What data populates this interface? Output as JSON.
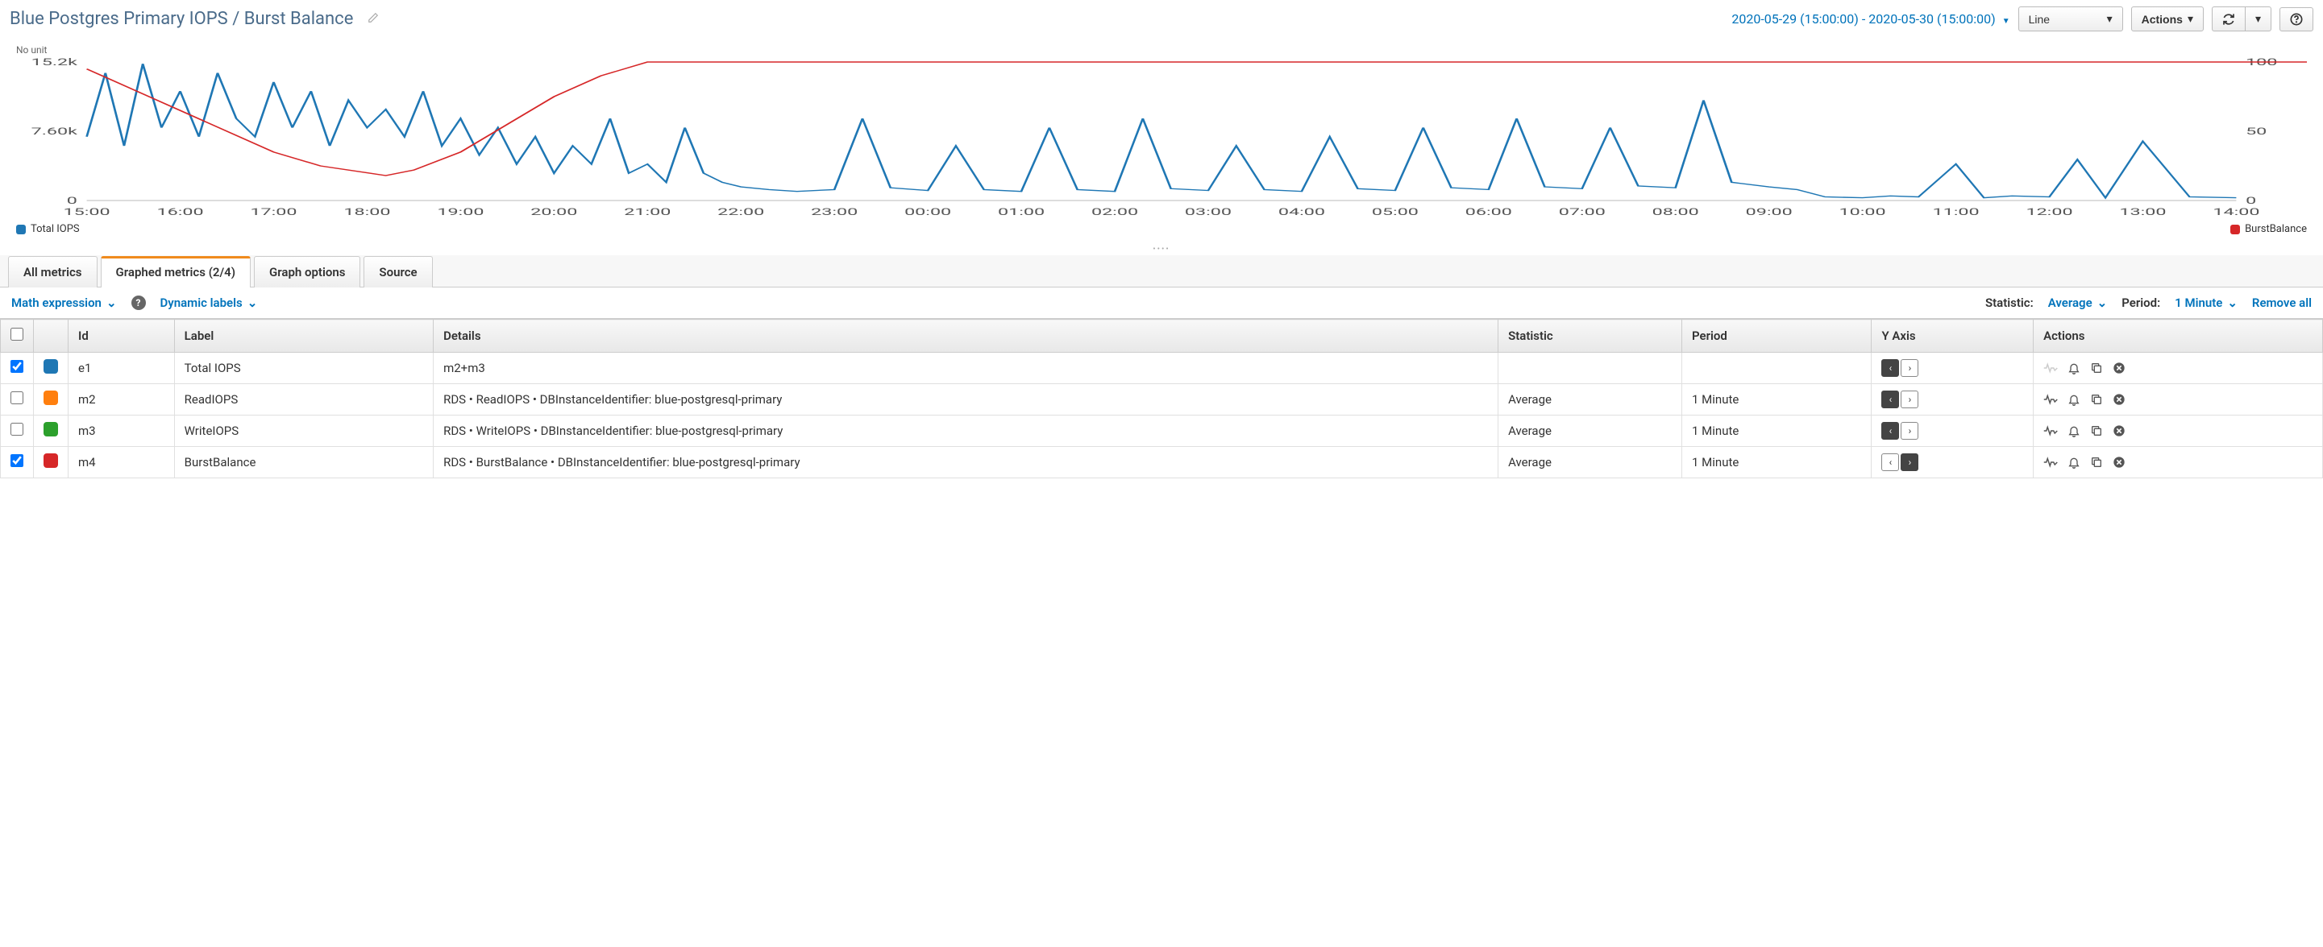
{
  "header": {
    "title": "Blue Postgres Primary IOPS / Burst Balance",
    "time_range": "2020-05-29 (15:00:00) - 2020-05-30 (15:00:00)",
    "chart_type": "Line",
    "actions_label": "Actions"
  },
  "chart": {
    "no_unit_label": "No unit",
    "legend_left": "Total IOPS",
    "legend_right": "BurstBalance",
    "colors": {
      "total_iops": "#1f77b4",
      "burst": "#d62728"
    }
  },
  "chart_data": {
    "type": "line",
    "xlabel": "",
    "x_ticks": [
      "15:00",
      "16:00",
      "17:00",
      "18:00",
      "19:00",
      "20:00",
      "21:00",
      "22:00",
      "23:00",
      "00:00",
      "01:00",
      "02:00",
      "03:00",
      "04:00",
      "05:00",
      "06:00",
      "07:00",
      "08:00",
      "09:00",
      "10:00",
      "11:00",
      "12:00",
      "13:00",
      "14:00"
    ],
    "y_left": {
      "label": "",
      "ticks": [
        0,
        7600,
        15200
      ],
      "tick_labels": [
        "0",
        "7.60k",
        "15.2k"
      ],
      "ylim": [
        0,
        15200
      ]
    },
    "y_right": {
      "label": "",
      "ticks": [
        0,
        50,
        100
      ],
      "ylim": [
        0,
        100
      ]
    },
    "series": [
      {
        "name": "Total IOPS",
        "axis": "left",
        "color": "#1f77b4",
        "x": [
          0,
          0.2,
          0.4,
          0.6,
          0.8,
          1,
          1.2,
          1.4,
          1.6,
          1.8,
          2,
          2.2,
          2.4,
          2.6,
          2.8,
          3,
          3.2,
          3.4,
          3.6,
          3.8,
          4,
          4.2,
          4.4,
          4.6,
          4.8,
          5,
          5.2,
          5.4,
          5.6,
          5.8,
          6,
          6.2,
          6.4,
          6.6,
          6.8,
          7,
          7.3,
          7.6,
          8,
          8.3,
          8.6,
          9,
          9.3,
          9.6,
          10,
          10.3,
          10.6,
          11,
          11.3,
          11.6,
          12,
          12.3,
          12.6,
          13,
          13.3,
          13.6,
          14,
          14.3,
          14.6,
          15,
          15.3,
          15.6,
          16,
          16.3,
          16.6,
          17,
          17.3,
          17.6,
          18,
          18.3,
          18.6,
          19,
          19.3,
          19.6,
          20,
          20.3,
          20.6,
          21,
          21.3,
          21.6,
          22,
          22.5,
          23,
          23.5
        ],
        "values": [
          7000,
          14000,
          6000,
          15000,
          8000,
          12000,
          7000,
          14000,
          9000,
          7000,
          13000,
          8000,
          12000,
          6000,
          11000,
          8000,
          10000,
          7000,
          12000,
          6000,
          9000,
          5000,
          8000,
          4000,
          7000,
          3000,
          6000,
          4000,
          9000,
          3000,
          4000,
          2000,
          8000,
          3000,
          2000,
          1500,
          1200,
          1000,
          1200,
          9000,
          1400,
          1100,
          6000,
          1200,
          1000,
          8000,
          1200,
          1000,
          9000,
          1300,
          1100,
          6000,
          1200,
          1000,
          7000,
          1300,
          1100,
          8000,
          1400,
          1200,
          9000,
          1500,
          1300,
          8000,
          1600,
          1400,
          11000,
          2000,
          1500,
          1200,
          400,
          300,
          500,
          400,
          4000,
          300,
          500,
          400,
          4500,
          300,
          6500,
          400,
          300
        ]
      },
      {
        "name": "BurstBalance",
        "axis": "right",
        "color": "#d62728",
        "x": [
          0,
          0.5,
          1,
          1.5,
          2,
          2.5,
          3,
          3.2,
          3.5,
          4,
          4.5,
          5,
          5.5,
          6,
          24
        ],
        "values": [
          95,
          80,
          65,
          50,
          35,
          25,
          20,
          18,
          22,
          35,
          55,
          75,
          90,
          100,
          100
        ]
      }
    ]
  },
  "tabs": {
    "all_metrics": "All metrics",
    "graphed_metrics": "Graphed metrics (2/4)",
    "graph_options": "Graph options",
    "source": "Source"
  },
  "toolbar": {
    "math_expression": "Math expression",
    "dynamic_labels": "Dynamic labels",
    "statistic_label": "Statistic:",
    "statistic_value": "Average",
    "period_label": "Period:",
    "period_value": "1 Minute",
    "remove_all": "Remove all"
  },
  "table": {
    "headers": {
      "id": "Id",
      "label": "Label",
      "details": "Details",
      "statistic": "Statistic",
      "period": "Period",
      "yaxis": "Y Axis",
      "actions": "Actions"
    },
    "rows": [
      {
        "checked": true,
        "color": "#1f77b4",
        "id": "e1",
        "label": "Total IOPS",
        "details": "m2+m3",
        "statistic": "",
        "period": "",
        "yaxis": "left",
        "pulse_enabled": false
      },
      {
        "checked": false,
        "color": "#ff7f0e",
        "id": "m2",
        "label": "ReadIOPS",
        "details": "RDS • ReadIOPS • DBInstanceIdentifier: blue-postgresql-primary",
        "statistic": "Average",
        "period": "1 Minute",
        "yaxis": "left",
        "pulse_enabled": true
      },
      {
        "checked": false,
        "color": "#2ca02c",
        "id": "m3",
        "label": "WriteIOPS",
        "details": "RDS • WriteIOPS • DBInstanceIdentifier: blue-postgresql-primary",
        "statistic": "Average",
        "period": "1 Minute",
        "yaxis": "left",
        "pulse_enabled": true
      },
      {
        "checked": true,
        "color": "#d62728",
        "id": "m4",
        "label": "BurstBalance",
        "details": "RDS • BurstBalance • DBInstanceIdentifier: blue-postgresql-primary",
        "statistic": "Average",
        "period": "1 Minute",
        "yaxis": "right",
        "pulse_enabled": true
      }
    ]
  }
}
